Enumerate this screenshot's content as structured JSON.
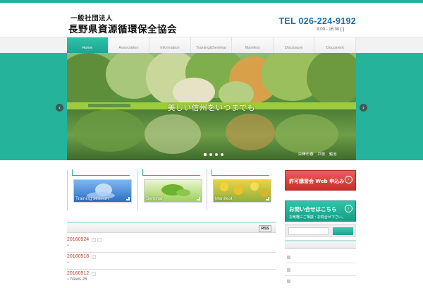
{
  "header": {
    "org_type": "一般社団法人",
    "org_name": "長野県資源循環保全協会",
    "tel": "TEL 026-224-9192",
    "hours": "9:00 - 16:30 [ ]"
  },
  "nav": {
    "items": [
      "Home",
      "Association",
      "Information",
      "Training&Seminar",
      "Manifest",
      "Disclosure",
      "Document"
    ],
    "active": "Home"
  },
  "hero": {
    "caption": "美しい信州をいつまでも",
    "credit": "白樺の春　戸隠　鏡池",
    "slides": 4,
    "active_slide": 1,
    "prev": "‹",
    "next": "›"
  },
  "cards": [
    {
      "label": "Training session"
    },
    {
      "label": "Seminar"
    },
    {
      "label": "Manifest"
    }
  ],
  "feed": {
    "rss_label": "RSS"
  },
  "news": [
    {
      "date": "20160524",
      "bullet": "•",
      "text": ""
    },
    {
      "date": "20160518",
      "bullet": "•",
      "text": ""
    },
    {
      "date": "20160512",
      "bullet": "•",
      "text": "News 26"
    }
  ],
  "sidebar": {
    "banner_apply": "許可講習会 Web 申込み",
    "banner_contact": "お問い合せはこちら",
    "banner_contact_sub": "お気軽にご相談・お問合せ下さい。",
    "banner_arrow": "›",
    "search_placeholder": ""
  },
  "colors": {
    "accent": "#1fb39b",
    "tel": "#1b6ea8",
    "news_date": "#c0392b",
    "banner_red": "#d23d38"
  }
}
